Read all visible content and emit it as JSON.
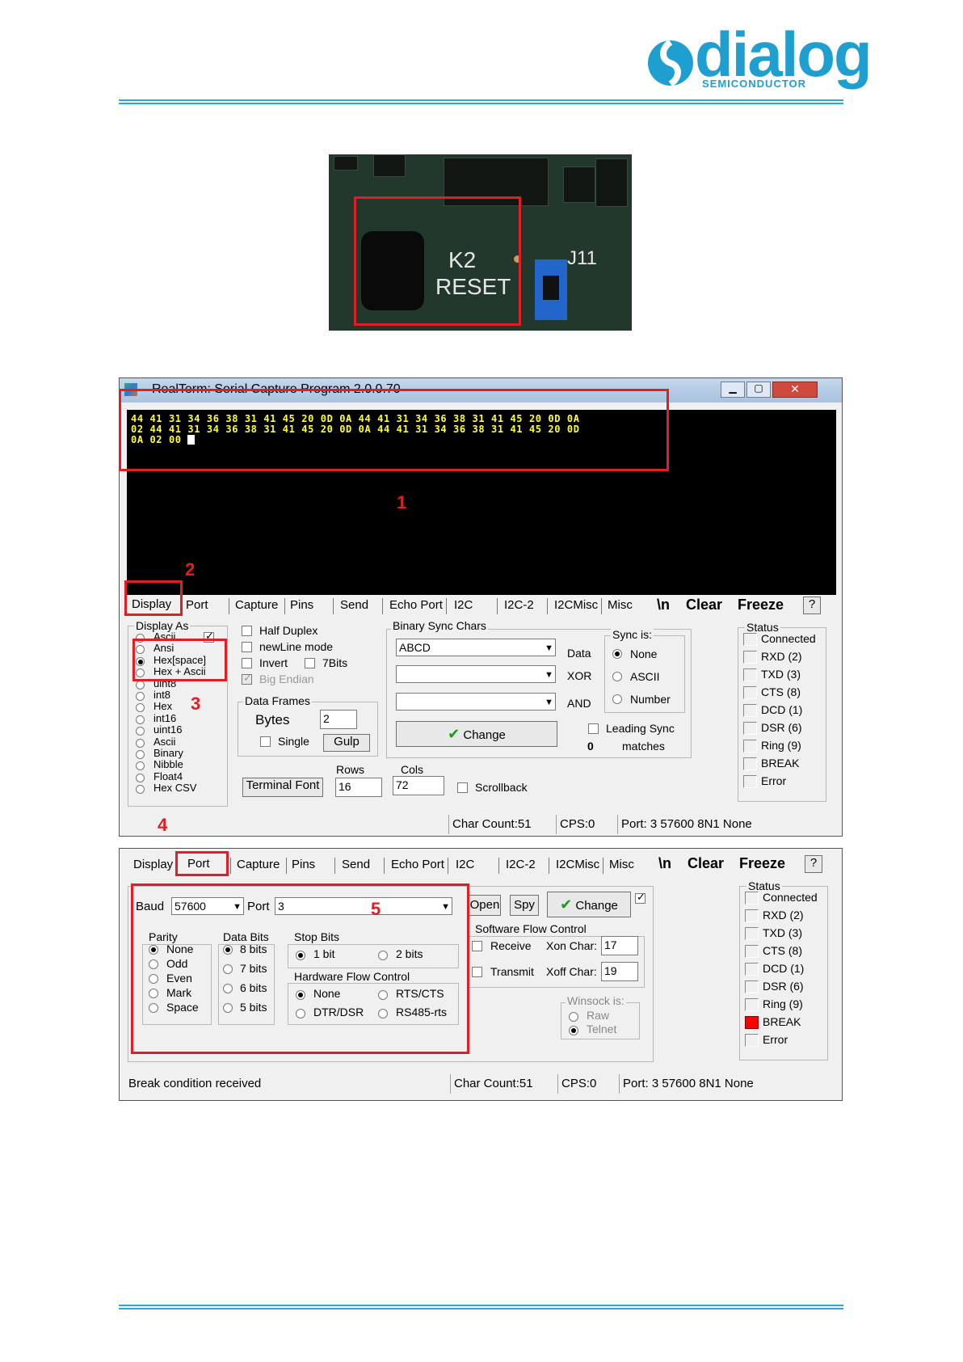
{
  "logo": {
    "wordmark": "dialog",
    "tagline": "SEMICONDUCTOR"
  },
  "photo": {
    "label_k2": "K2",
    "label_reset": "RESET",
    "label_j11": "J11"
  },
  "window1": {
    "title": "RealTerm: Serial Capture Program 2.0.0.70",
    "terminal_lines": [
      "44 41 31 34 36 38 31 41 45 20 0D 0A 44 41 31 34 36 38 31 41 45 20 0D 0A",
      "02 44 41 31 34 36 38 31 41 45 20 0D 0A 44 41 31 34 36 38 31 41 45 20 0D",
      "0A 02 00 "
    ],
    "tabs": [
      "Display",
      "Port",
      "Capture",
      "Pins",
      "Send",
      "Echo Port",
      "I2C",
      "I2C-2",
      "I2CMisc",
      "Misc"
    ],
    "newline_button": "\\n",
    "clear_button": "Clear",
    "freeze_button": "Freeze",
    "help_button": "?",
    "display_as_title": "Display As",
    "display_as_options": [
      "Ascii",
      "Ansi",
      "Hex[space]",
      "Hex + Ascii",
      "uint8",
      "int8",
      "Hex",
      "int16",
      "uint16",
      "Ascii",
      "Binary",
      "Nibble",
      "Float4",
      "Hex CSV"
    ],
    "half_duplex": "Half Duplex",
    "newline_mode": "newLine mode",
    "invert": "Invert",
    "seven_bits": "7Bits",
    "big_endian": "Big Endian",
    "data_frames_title": "Data Frames",
    "bytes_label": "Bytes",
    "bytes_value": "2",
    "single": "Single",
    "gulp": "Gulp",
    "binary_sync_title": "Binary Sync Chars",
    "sync_field": "ABCD",
    "data_label": "Data",
    "xor_label": "XOR",
    "and_label": "AND",
    "sync_is_title": "Sync is:",
    "sync_options": [
      "None",
      "ASCII",
      "Number"
    ],
    "leading_sync": "Leading Sync",
    "matches_count": "0",
    "matches_label": "matches",
    "change_button": "Change",
    "rows_label": "Rows",
    "cols_label": "Cols",
    "rows_value": "16",
    "cols_value": "72",
    "terminal_font": "Terminal Font",
    "scrollback": "Scrollback",
    "status_title": "Status",
    "status_items": [
      "Connected",
      "RXD (2)",
      "TXD (3)",
      "CTS (8)",
      "DCD (1)",
      "DSR (6)",
      "Ring (9)",
      "BREAK",
      "Error"
    ],
    "char_count": "Char Count:51",
    "cps": "CPS:0",
    "port_info": "Port: 3 57600 8N1 None"
  },
  "window2": {
    "tabs": [
      "Display",
      "Port",
      "Capture",
      "Pins",
      "Send",
      "Echo Port",
      "I2C",
      "I2C-2",
      "I2CMisc",
      "Misc"
    ],
    "newline_button": "\\n",
    "clear_button": "Clear",
    "freeze_button": "Freeze",
    "help_button": "?",
    "baud_label": "Baud",
    "baud_value": "57600",
    "port_label": "Port",
    "port_value": "3",
    "open_button": "Open",
    "spy_button": "Spy",
    "change_button": "Change",
    "parity_title": "Parity",
    "parity_options": [
      "None",
      "Odd",
      "Even",
      "Mark",
      "Space"
    ],
    "data_bits_title": "Data Bits",
    "data_bits_options": [
      "8 bits",
      "7 bits",
      "6 bits",
      "5 bits"
    ],
    "stop_bits_title": "Stop Bits",
    "stop_bits_options": [
      "1 bit",
      "2 bits"
    ],
    "hw_flow_title": "Hardware Flow Control",
    "hw_flow_options": [
      "None",
      "RTS/CTS",
      "DTR/DSR",
      "RS485-rts"
    ],
    "sw_flow_title": "Software Flow Control",
    "receive_label": "Receive",
    "xon_label": "Xon Char:",
    "xon_value": "17",
    "transmit_label": "Transmit",
    "xoff_label": "Xoff Char:",
    "xoff_value": "19",
    "winsock_title": "Winsock is:",
    "winsock_options": [
      "Raw",
      "Telnet"
    ],
    "status_title": "Status",
    "status_items": [
      "Connected",
      "RXD (2)",
      "TXD (3)",
      "CTS (8)",
      "DCD (1)",
      "DSR (6)",
      "Ring (9)",
      "BREAK",
      "Error"
    ],
    "status_message": "Break condition received",
    "char_count": "Char Count:51",
    "cps": "CPS:0",
    "port_info": "Port: 3 57600 8N1 None"
  },
  "annotations": [
    "1",
    "2",
    "3",
    "4",
    "5"
  ],
  "colors": {
    "brand": "#1f9fd0",
    "annotation": "#e01e26",
    "terminal_text": "#ffff33",
    "break_led": "#ff0000"
  }
}
